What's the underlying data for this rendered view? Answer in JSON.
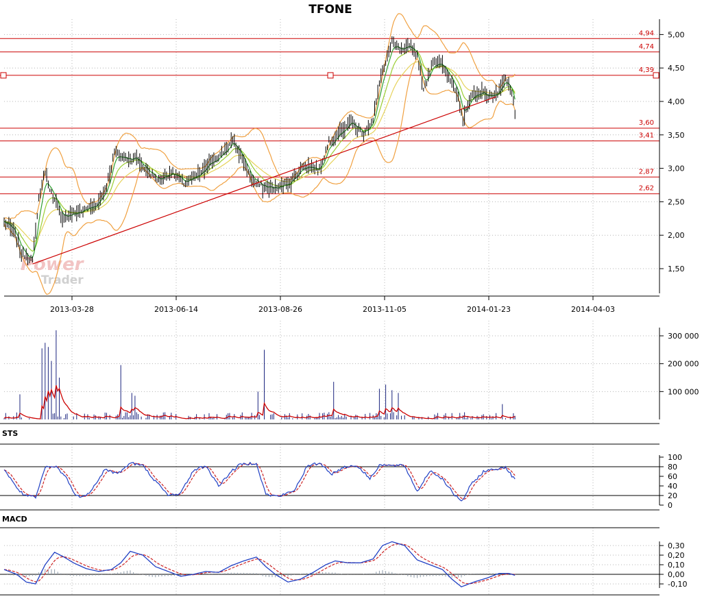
{
  "title": "TFONE",
  "watermark": {
    "line1": "Power",
    "line2": "Trader"
  },
  "colors": {
    "level": "#cc0000",
    "candle": "#000000",
    "bollinger": "#f0a040",
    "ma_fast": "#2e9e2e",
    "ma_mid": "#9acd32",
    "ma_slow": "#e6d25a",
    "volume_bar": "#1a237e",
    "volume_avg": "#cc0000",
    "sts_k": "#1f3fc4",
    "sts_d": "#cc2222",
    "macd_line": "#1f3fc4",
    "macd_signal": "#cc2222",
    "macd_hist": "#8c9aa8",
    "grid": "#b4b4b4"
  },
  "x_labels": [
    "2013-03-28",
    "2013-06-14",
    "2013-08-26",
    "2013-11-05",
    "2014-01-23",
    "2014-04-03"
  ],
  "chart_data": [
    {
      "type": "line",
      "name": "price",
      "title": "TFONE",
      "ylim": [
        1.15,
        5.12
      ],
      "yticks": [
        "1,50",
        "2,00",
        "2,50",
        "3,00",
        "3,50",
        "4,00",
        "4,50",
        "5,00"
      ],
      "ytick_values": [
        1.5,
        2.0,
        2.5,
        3.0,
        3.5,
        4.0,
        4.5,
        5.0
      ],
      "levels": [
        {
          "label": "4,94",
          "value": 4.94
        },
        {
          "label": "4,74",
          "value": 4.74
        },
        {
          "label": "4,39",
          "value": 4.39
        },
        {
          "label": "3,60",
          "value": 3.6
        },
        {
          "label": "3,41",
          "value": 3.41
        },
        {
          "label": "2,87",
          "value": 2.87
        },
        {
          "label": "2,62",
          "value": 2.62
        }
      ],
      "trendline": [
        {
          "bar": 18,
          "value": 1.57
        },
        {
          "bar": 312,
          "value": 4.07
        }
      ],
      "key_points": [
        [
          0,
          2.2
        ],
        [
          6,
          2.05
        ],
        [
          11,
          1.75
        ],
        [
          18,
          1.62
        ],
        [
          22,
          2.55
        ],
        [
          26,
          2.95
        ],
        [
          31,
          2.55
        ],
        [
          37,
          2.25
        ],
        [
          44,
          2.32
        ],
        [
          51,
          2.38
        ],
        [
          58,
          2.45
        ],
        [
          65,
          2.72
        ],
        [
          70,
          3.25
        ],
        [
          76,
          3.15
        ],
        [
          84,
          3.15
        ],
        [
          91,
          2.95
        ],
        [
          98,
          2.82
        ],
        [
          106,
          2.95
        ],
        [
          114,
          2.78
        ],
        [
          124,
          2.9
        ],
        [
          130,
          3.08
        ],
        [
          137,
          3.2
        ],
        [
          145,
          3.4
        ],
        [
          150,
          3.2
        ],
        [
          157,
          2.82
        ],
        [
          164,
          2.72
        ],
        [
          174,
          2.7
        ],
        [
          182,
          2.82
        ],
        [
          190,
          3.05
        ],
        [
          200,
          2.98
        ],
        [
          206,
          3.4
        ],
        [
          213,
          3.55
        ],
        [
          220,
          3.7
        ],
        [
          228,
          3.5
        ],
        [
          234,
          3.75
        ],
        [
          238,
          4.25
        ],
        [
          242,
          4.6
        ],
        [
          246,
          4.88
        ],
        [
          252,
          4.75
        ],
        [
          258,
          4.82
        ],
        [
          262,
          4.7
        ],
        [
          266,
          4.15
        ],
        [
          272,
          4.62
        ],
        [
          278,
          4.52
        ],
        [
          284,
          4.3
        ],
        [
          288,
          4.1
        ],
        [
          291,
          3.72
        ],
        [
          296,
          4.05
        ],
        [
          302,
          4.15
        ],
        [
          310,
          4.05
        ],
        [
          315,
          4.22
        ],
        [
          318,
          4.35
        ],
        [
          321,
          4.22
        ],
        [
          324,
          3.85
        ]
      ]
    },
    {
      "type": "bar",
      "name": "volume",
      "ylim": [
        0,
        340000
      ],
      "yticks": [
        "100 000",
        "200 000",
        "300 000"
      ],
      "ytick_values": [
        100000,
        200000,
        300000
      ],
      "spikes": [
        [
          10,
          90000
        ],
        [
          24,
          255000
        ],
        [
          26,
          275000
        ],
        [
          28,
          260000
        ],
        [
          30,
          210000
        ],
        [
          33,
          320000
        ],
        [
          35,
          150000
        ],
        [
          74,
          195000
        ],
        [
          81,
          95000
        ],
        [
          83,
          85000
        ],
        [
          165,
          250000
        ],
        [
          161,
          100000
        ],
        [
          209,
          135000
        ],
        [
          238,
          110000
        ],
        [
          242,
          125000
        ],
        [
          246,
          105000
        ],
        [
          250,
          95000
        ],
        [
          316,
          55000
        ]
      ]
    },
    {
      "type": "line",
      "name": "STS",
      "ylim": [
        0,
        100
      ],
      "yticks": [
        "0",
        "20",
        "40",
        "60",
        "80",
        "100"
      ],
      "ytick_values": [
        0,
        20,
        40,
        60,
        80,
        100
      ],
      "levels": [
        20,
        80
      ],
      "key_points": [
        [
          0,
          75
        ],
        [
          6,
          45
        ],
        [
          12,
          22
        ],
        [
          20,
          15
        ],
        [
          26,
          78
        ],
        [
          33,
          80
        ],
        [
          40,
          55
        ],
        [
          45,
          20
        ],
        [
          52,
          18
        ],
        [
          58,
          45
        ],
        [
          64,
          75
        ],
        [
          72,
          65
        ],
        [
          80,
          88
        ],
        [
          88,
          82
        ],
        [
          96,
          50
        ],
        [
          104,
          20
        ],
        [
          112,
          25
        ],
        [
          120,
          72
        ],
        [
          128,
          82
        ],
        [
          136,
          40
        ],
        [
          144,
          70
        ],
        [
          150,
          85
        ],
        [
          160,
          88
        ],
        [
          166,
          22
        ],
        [
          174,
          18
        ],
        [
          184,
          30
        ],
        [
          192,
          80
        ],
        [
          200,
          88
        ],
        [
          208,
          65
        ],
        [
          216,
          80
        ],
        [
          224,
          82
        ],
        [
          232,
          55
        ],
        [
          238,
          84
        ],
        [
          246,
          82
        ],
        [
          254,
          82
        ],
        [
          262,
          28
        ],
        [
          270,
          72
        ],
        [
          278,
          55
        ],
        [
          284,
          28
        ],
        [
          290,
          6
        ],
        [
          296,
          42
        ],
        [
          304,
          70
        ],
        [
          312,
          75
        ],
        [
          318,
          80
        ],
        [
          324,
          52
        ]
      ]
    },
    {
      "type": "line",
      "name": "MACD",
      "ylim": [
        -0.15,
        0.35
      ],
      "yticks": [
        "-0,10",
        "0,00",
        "0,10",
        "0,20",
        "0,30"
      ],
      "ytick_values": [
        -0.1,
        0.0,
        0.1,
        0.2,
        0.3
      ],
      "key_points": [
        [
          0,
          0.05
        ],
        [
          8,
          0.0
        ],
        [
          14,
          -0.08
        ],
        [
          20,
          -0.1
        ],
        [
          26,
          0.1
        ],
        [
          32,
          0.23
        ],
        [
          38,
          0.18
        ],
        [
          44,
          0.12
        ],
        [
          52,
          0.06
        ],
        [
          60,
          0.03
        ],
        [
          68,
          0.05
        ],
        [
          74,
          0.12
        ],
        [
          80,
          0.24
        ],
        [
          88,
          0.2
        ],
        [
          96,
          0.08
        ],
        [
          104,
          0.03
        ],
        [
          112,
          -0.02
        ],
        [
          120,
          0.0
        ],
        [
          128,
          0.03
        ],
        [
          136,
          0.02
        ],
        [
          144,
          0.09
        ],
        [
          152,
          0.14
        ],
        [
          160,
          0.18
        ],
        [
          166,
          0.08
        ],
        [
          172,
          0.0
        ],
        [
          180,
          -0.08
        ],
        [
          188,
          -0.05
        ],
        [
          196,
          0.02
        ],
        [
          204,
          0.1
        ],
        [
          210,
          0.14
        ],
        [
          218,
          0.12
        ],
        [
          226,
          0.12
        ],
        [
          234,
          0.16
        ],
        [
          240,
          0.3
        ],
        [
          246,
          0.34
        ],
        [
          254,
          0.3
        ],
        [
          262,
          0.15
        ],
        [
          270,
          0.1
        ],
        [
          278,
          0.05
        ],
        [
          284,
          -0.05
        ],
        [
          290,
          -0.13
        ],
        [
          298,
          -0.08
        ],
        [
          306,
          -0.04
        ],
        [
          314,
          0.01
        ],
        [
          320,
          0.01
        ],
        [
          324,
          -0.01
        ]
      ]
    }
  ],
  "panels": {
    "sts_label": "STS",
    "macd_label": "MACD"
  }
}
